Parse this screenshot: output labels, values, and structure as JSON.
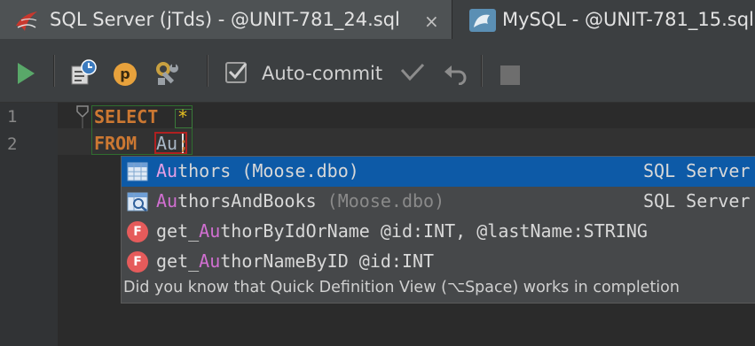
{
  "tabs": [
    {
      "label": "SQL Server (jTds) - @UNIT-781_24.sql",
      "close": "×"
    },
    {
      "label": "MySQL - @UNIT-781_15.sql"
    }
  ],
  "toolbar": {
    "autocommit_label": "Auto-commit",
    "autocommit_checked": true,
    "icons": [
      "run-icon",
      "transaction-history-icon",
      "parameters-p-icon",
      "settings-wrench-icon",
      "autocommit-checkbox",
      "commit-checkmark-icon",
      "rollback-undo-icon",
      "stop-icon"
    ],
    "p_label": "p"
  },
  "editor": {
    "line_numbers": [
      "1",
      "2"
    ],
    "line1": {
      "keyword": "SELECT",
      "star": "*"
    },
    "line2": {
      "keyword": "FROM",
      "identifier": "Au",
      "semicolon": ";"
    }
  },
  "completion": {
    "items": [
      {
        "match": "Au",
        "rest": "thors",
        "suffix": " (Moose.dbo)",
        "type": "SQL Server",
        "icon": "table-icon",
        "selected": true
      },
      {
        "match": "Au",
        "rest": "thorsAndBooks",
        "suffix": " (Moose.dbo)",
        "type": "SQL Server",
        "icon": "view-icon",
        "selected": false
      },
      {
        "prefix": "get_",
        "match": "Au",
        "rest": "thorByIdOrName @id:INT, @lastName:STRING",
        "icon": "function-icon",
        "icon_letter": "F",
        "selected": false
      },
      {
        "prefix": "get_",
        "match": "Au",
        "rest": "thorNameByID @id:INT",
        "icon": "function-icon",
        "icon_letter": "F",
        "selected": false
      }
    ],
    "hint": "Did you know that Quick Definition View (⌥Space) works in completion"
  },
  "colors": {
    "keyword": "#cc7832",
    "selection": "#0d5aa7",
    "match": "#d16fd1"
  }
}
